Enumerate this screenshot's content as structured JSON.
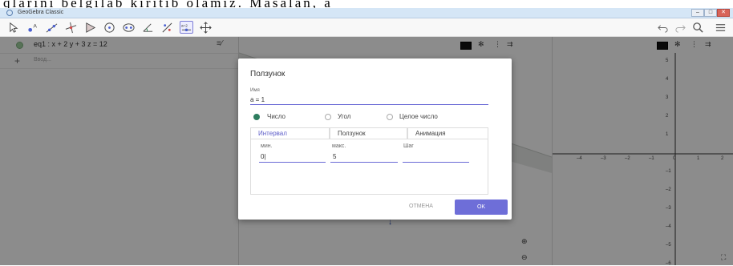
{
  "doc_strip": {
    "text": "qlarini  belgilab  kiritib  olamiz.  Masalan,  a"
  },
  "window": {
    "title": "GeoGebra Classic",
    "min": "–",
    "max": "□",
    "close": "✕"
  },
  "toolbar": {
    "tools": [
      "move-tool",
      "point-tool",
      "line-tool",
      "perpendicular-tool",
      "polygon-tool",
      "circle-tool",
      "ellipse-tool",
      "angle-tool",
      "reflect-tool",
      "slider-tool",
      "move-view-tool"
    ],
    "slider_tool_text": "a=2",
    "right": [
      "undo-icon",
      "redo-icon",
      "search-icon",
      "menu-icon"
    ]
  },
  "algebra": {
    "equation": "eq1 : x + 2 y + 3 z = 12",
    "input_placeholder": "Ввод..."
  },
  "axis": {
    "x_ticks": [
      "–4",
      "–3",
      "–2",
      "–1",
      "0",
      "1",
      "2"
    ],
    "y_ticks": [
      "5",
      "4",
      "3",
      "2",
      "1",
      "–1",
      "–2",
      "–3",
      "–4",
      "–5",
      "–6"
    ]
  },
  "dialog": {
    "title": "Ползунок",
    "name_label": "Имя",
    "name_value": "a = 1",
    "radios": [
      {
        "label": "Число",
        "selected": true
      },
      {
        "label": "Угол",
        "selected": false
      },
      {
        "label": "Целое число",
        "selected": false
      }
    ],
    "tabs": [
      "Интервал",
      "Ползунок",
      "Анимация"
    ],
    "fields": [
      {
        "label": "мин.",
        "value": "0|"
      },
      {
        "label": "макс.",
        "value": "5"
      },
      {
        "label": "Шаг",
        "value": ""
      }
    ],
    "cancel": "ОТМЕНА",
    "ok": "OK"
  },
  "view1_label": "a",
  "colors": {
    "accent": "#6e6ed8",
    "selected_radio": "#2e7d5f",
    "plane": "#c8ccc8"
  }
}
